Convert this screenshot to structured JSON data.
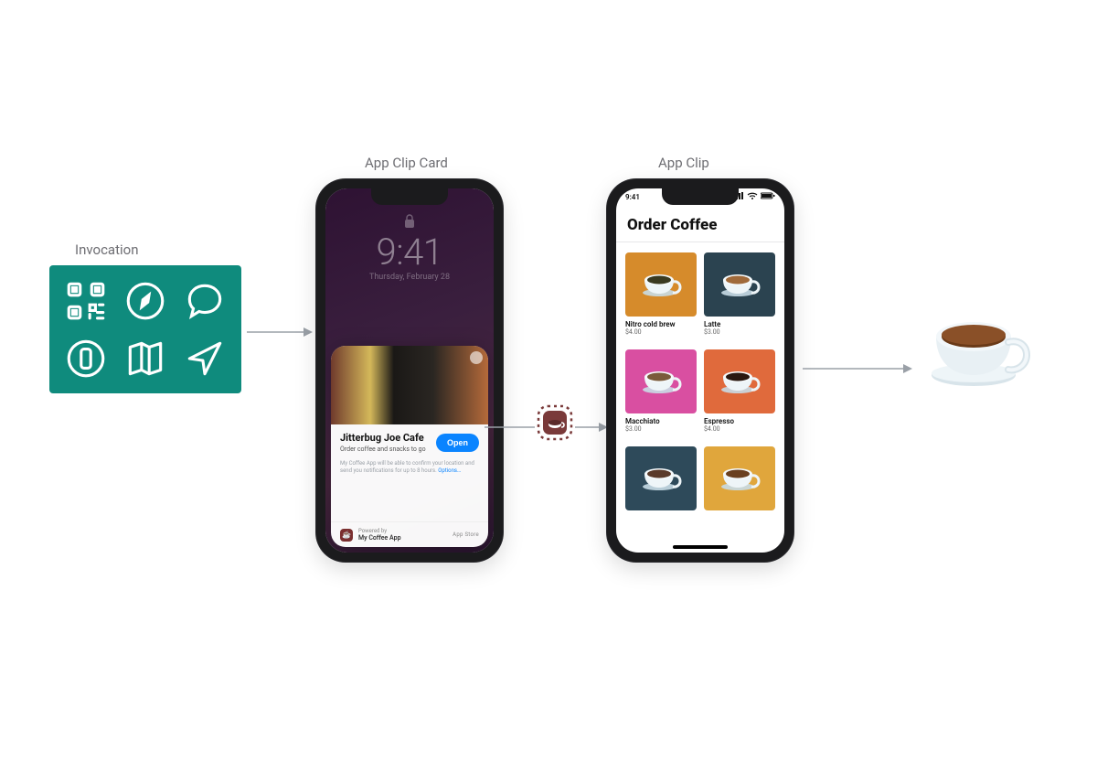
{
  "labels": {
    "invocation": "Invocation",
    "appClipCard": "App Clip Card",
    "appClip": "App Clip"
  },
  "invocation_icons": [
    {
      "name": "qr-code-icon"
    },
    {
      "name": "compass-icon"
    },
    {
      "name": "chat-bubble-icon"
    },
    {
      "name": "nfc-tag-icon"
    },
    {
      "name": "map-icon"
    },
    {
      "name": "location-arrow-icon"
    }
  ],
  "lockscreen": {
    "time": "9:41",
    "date": "Thursday, February 28"
  },
  "clipCard": {
    "title": "Jitterbug Joe Cafe",
    "subtitle": "Order coffee and snacks to go",
    "openLabel": "Open",
    "finePrint": "My Coffee App will be able to confirm your location and send you notifications for up to 8 hours.",
    "optionsLabel": "Options…",
    "poweredByLabel": "Powered by",
    "appName": "My Coffee App",
    "appStoreLabel": "App Store"
  },
  "statusbar": {
    "time": "9:41"
  },
  "appClip": {
    "title": "Order Coffee",
    "menu": [
      {
        "name": "Nitro cold brew",
        "price": "$4.00",
        "bg": "#d68b2b",
        "coffee": "#3a3a20"
      },
      {
        "name": "Latte",
        "price": "$3.00",
        "bg": "#2b4350",
        "coffee": "#a06a3a"
      },
      {
        "name": "Macchiato",
        "price": "$3.00",
        "bg": "#d94fa1",
        "coffee": "#7a5a3a"
      },
      {
        "name": "Espresso",
        "price": "$4.00",
        "bg": "#e06a3c",
        "coffee": "#2a1810"
      },
      {
        "name": "",
        "price": "",
        "bg": "#2e4a5a",
        "coffee": "#5a3a2a"
      },
      {
        "name": "",
        "price": "",
        "bg": "#e0a63c",
        "coffee": "#6a4020"
      }
    ]
  }
}
